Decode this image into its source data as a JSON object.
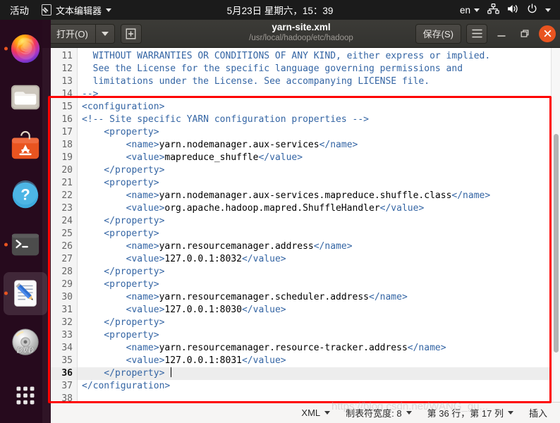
{
  "topbar": {
    "activities": "活动",
    "app_menu": "文本编辑器",
    "clock": "5月23日 星期六，15：39",
    "language": "en",
    "icons": [
      "text-editor-icon",
      "network-icon",
      "volume-icon",
      "power-icon",
      "system-menu-caret-icon"
    ]
  },
  "dock": {
    "items": [
      {
        "name": "firefox",
        "label": "Firefox",
        "running": true,
        "active": false
      },
      {
        "name": "files",
        "label": "文件",
        "running": false,
        "active": false
      },
      {
        "name": "ubuntu-software",
        "label": "Ubuntu 软件",
        "running": false,
        "active": false
      },
      {
        "name": "help",
        "label": "帮助",
        "running": false,
        "active": false
      },
      {
        "name": "terminal",
        "label": "终端",
        "running": true,
        "active": false
      },
      {
        "name": "text-editor",
        "label": "文本编辑器",
        "running": true,
        "active": true
      },
      {
        "name": "dvd",
        "label": "DVD",
        "running": false,
        "active": false
      },
      {
        "name": "show-apps",
        "label": "显示应用程序",
        "running": false,
        "active": false
      }
    ]
  },
  "window": {
    "open_label": "打开(O)",
    "new_tab_label": "新建文档",
    "title": "yarn-site.xml",
    "subtitle": "/usr/local/hadoop/etc/hadoop",
    "save_label": "保存(S)",
    "menu_label": "主菜单",
    "minimize_label": "最小化",
    "maximize_label": "最大化",
    "close_label": "关闭"
  },
  "editor": {
    "first_line_number": 11,
    "current_line": 36,
    "lines": [
      {
        "n": 11,
        "segments": [
          {
            "t": "  WITHOUT WARRANTIES OR CONDITIONS OF ANY KIND, either express or implied.",
            "c": "cm"
          }
        ]
      },
      {
        "n": 12,
        "segments": [
          {
            "t": "  See the License for the specific language governing permissions and",
            "c": "cm"
          }
        ]
      },
      {
        "n": 13,
        "segments": [
          {
            "t": "  limitations under the License. See accompanying LICENSE file.",
            "c": "cm"
          }
        ]
      },
      {
        "n": 14,
        "segments": [
          {
            "t": "-->",
            "c": "cm"
          }
        ]
      },
      {
        "n": 15,
        "segments": [
          {
            "t": "<configuration>",
            "c": "tk"
          }
        ]
      },
      {
        "n": 16,
        "segments": [
          {
            "t": "<!-- Site specific YARN configuration properties -->",
            "c": "cm"
          }
        ]
      },
      {
        "n": 17,
        "segments": [
          {
            "t": "    <property>",
            "c": "tk"
          }
        ]
      },
      {
        "n": 18,
        "segments": [
          {
            "t": "        <name>",
            "c": "tk"
          },
          {
            "t": "yarn.nodemanager.aux-services",
            "c": "tx"
          },
          {
            "t": "</name>",
            "c": "tk"
          }
        ]
      },
      {
        "n": 19,
        "segments": [
          {
            "t": "        <value>",
            "c": "tk"
          },
          {
            "t": "mapreduce_shuffle",
            "c": "tx"
          },
          {
            "t": "</value>",
            "c": "tk"
          }
        ]
      },
      {
        "n": 20,
        "segments": [
          {
            "t": "    </property>",
            "c": "tk"
          }
        ]
      },
      {
        "n": 21,
        "segments": [
          {
            "t": "    <property>",
            "c": "tk"
          }
        ]
      },
      {
        "n": 22,
        "segments": [
          {
            "t": "        <name>",
            "c": "tk"
          },
          {
            "t": "yarn.nodemanager.aux-services.mapreduce.shuffle.class",
            "c": "tx"
          },
          {
            "t": "</name>",
            "c": "tk"
          }
        ]
      },
      {
        "n": 23,
        "segments": [
          {
            "t": "        <value>",
            "c": "tk"
          },
          {
            "t": "org.apache.hadoop.mapred.ShuffleHandler",
            "c": "tx"
          },
          {
            "t": "</value>",
            "c": "tk"
          }
        ]
      },
      {
        "n": 24,
        "segments": [
          {
            "t": "    </property>",
            "c": "tk"
          }
        ]
      },
      {
        "n": 25,
        "segments": [
          {
            "t": "    <property>",
            "c": "tk"
          }
        ]
      },
      {
        "n": 26,
        "segments": [
          {
            "t": "        <name>",
            "c": "tk"
          },
          {
            "t": "yarn.resourcemanager.address",
            "c": "tx"
          },
          {
            "t": "</name>",
            "c": "tk"
          }
        ]
      },
      {
        "n": 27,
        "segments": [
          {
            "t": "        <value>",
            "c": "tk"
          },
          {
            "t": "127.0.0.1:8032",
            "c": "tx"
          },
          {
            "t": "</value>",
            "c": "tk"
          }
        ]
      },
      {
        "n": 28,
        "segments": [
          {
            "t": "    </property>",
            "c": "tk"
          }
        ]
      },
      {
        "n": 29,
        "segments": [
          {
            "t": "    <property>",
            "c": "tk"
          }
        ]
      },
      {
        "n": 30,
        "segments": [
          {
            "t": "        <name>",
            "c": "tk"
          },
          {
            "t": "yarn.resourcemanager.scheduler.address",
            "c": "tx"
          },
          {
            "t": "</name>",
            "c": "tk"
          }
        ]
      },
      {
        "n": 31,
        "segments": [
          {
            "t": "        <value>",
            "c": "tk"
          },
          {
            "t": "127.0.0.1:8030",
            "c": "tx"
          },
          {
            "t": "</value>",
            "c": "tk"
          }
        ]
      },
      {
        "n": 32,
        "segments": [
          {
            "t": "    </property>",
            "c": "tk"
          }
        ]
      },
      {
        "n": 33,
        "segments": [
          {
            "t": "    <property>",
            "c": "tk"
          }
        ]
      },
      {
        "n": 34,
        "segments": [
          {
            "t": "        <name>",
            "c": "tk"
          },
          {
            "t": "yarn.resourcemanager.resource-tracker.address",
            "c": "tx"
          },
          {
            "t": "</name>",
            "c": "tk"
          }
        ]
      },
      {
        "n": 35,
        "segments": [
          {
            "t": "        <value>",
            "c": "tk"
          },
          {
            "t": "127.0.0.1:8031",
            "c": "tx"
          },
          {
            "t": "</value>",
            "c": "tk"
          }
        ]
      },
      {
        "n": 36,
        "segments": [
          {
            "t": "    </property> ",
            "c": "tk"
          }
        ],
        "cursor": true
      },
      {
        "n": 37,
        "segments": [
          {
            "t": "</configuration>",
            "c": "tk"
          }
        ]
      },
      {
        "n": 38,
        "segments": [
          {
            "t": "",
            "c": "tx"
          }
        ]
      }
    ]
  },
  "statusbar": {
    "language": "XML",
    "tab_width": "制表符宽度: 8",
    "position": "第 36 行，第 17 列",
    "mode": "插入"
  },
  "annotation": {
    "box_color": "#fe0000",
    "watermark": "https://blog.csdn.net/WANG_gu..."
  }
}
